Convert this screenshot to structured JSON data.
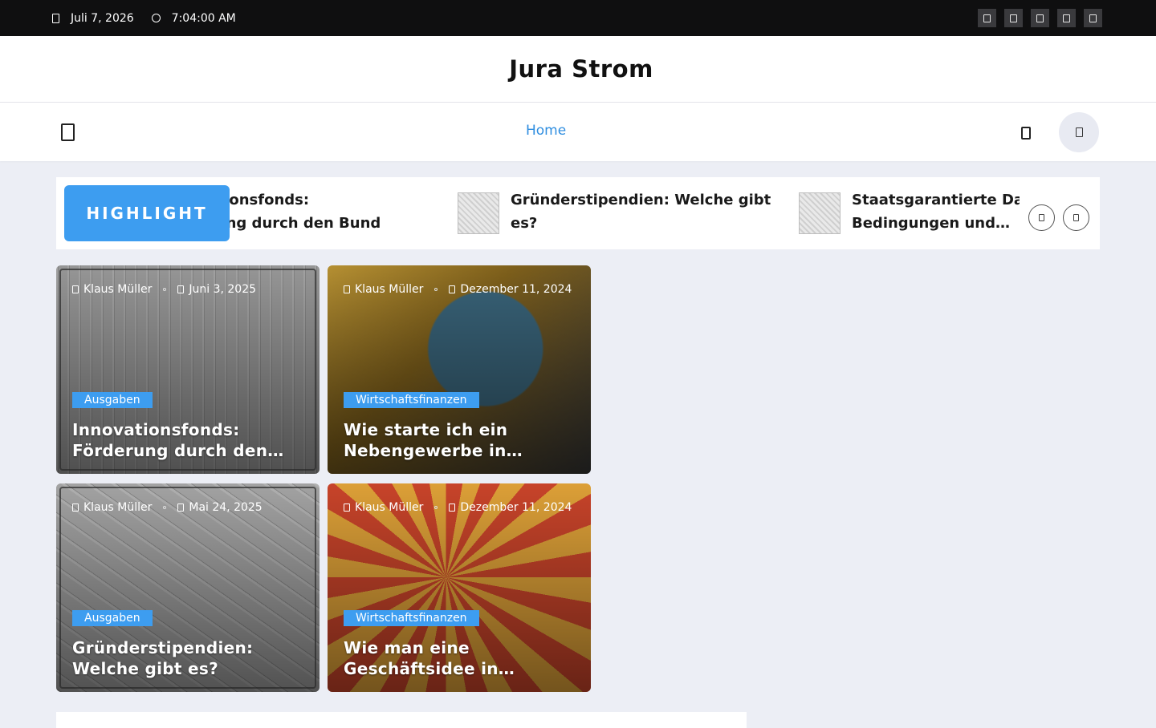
{
  "topbar": {
    "date": "Juli 7, 2026",
    "time": "7:04:00 AM",
    "socials": [
      "facebook-icon",
      "twitter-icon",
      "instagram-icon",
      "youtube-icon",
      "linkedin-icon"
    ]
  },
  "brand": {
    "name": "Jura Strom"
  },
  "nav": {
    "home": "Home"
  },
  "highlight": {
    "label": "HIGHLIGHT",
    "items": [
      {
        "title": "Innovationsfonds: Förderung durch den Bund"
      },
      {
        "title": "Gründerstipendien: Welche gibt es?"
      },
      {
        "title": "Staatsgarantierte Darlehen: Bedingungen und…"
      }
    ]
  },
  "cards": [
    {
      "author": "Klaus Müller",
      "date": "Juni 3, 2025",
      "category": "Ausgaben",
      "title": "Innovationsfonds: Förderung durch den…"
    },
    {
      "author": "Klaus Müller",
      "date": "Dezember 11, 2024",
      "category": "Wirtschaftsfinanzen",
      "title": "Wie starte ich ein Nebengewerbe in…"
    },
    {
      "author": "Klaus Müller",
      "date": "Mai 24, 2025",
      "category": "Ausgaben",
      "title": "Gründerstipendien: Welche gibt es?"
    },
    {
      "author": "Klaus Müller",
      "date": "Dezember 11, 2024",
      "category": "Wirtschaftsfinanzen",
      "title": "Wie man eine Geschäftsidee in…"
    }
  ],
  "colors": {
    "accent": "#3d9df0",
    "topbar": "#0f0f10",
    "background": "#eceef5"
  }
}
